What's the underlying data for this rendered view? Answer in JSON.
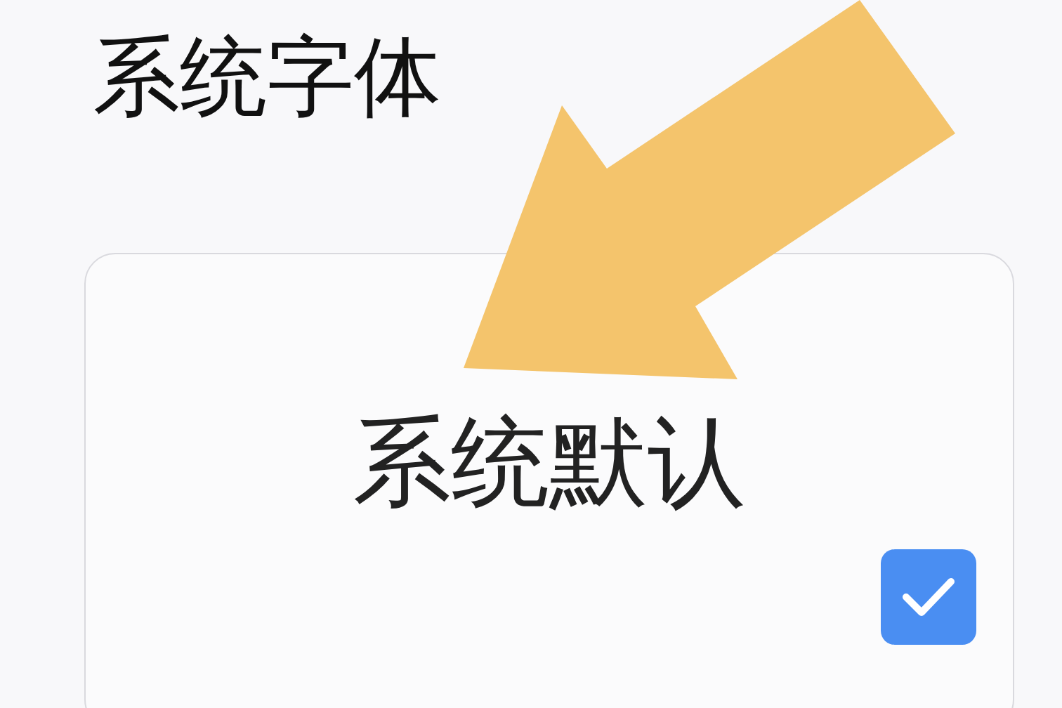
{
  "title": "系统字体",
  "option": {
    "label": "系统默认",
    "selected": true
  }
}
